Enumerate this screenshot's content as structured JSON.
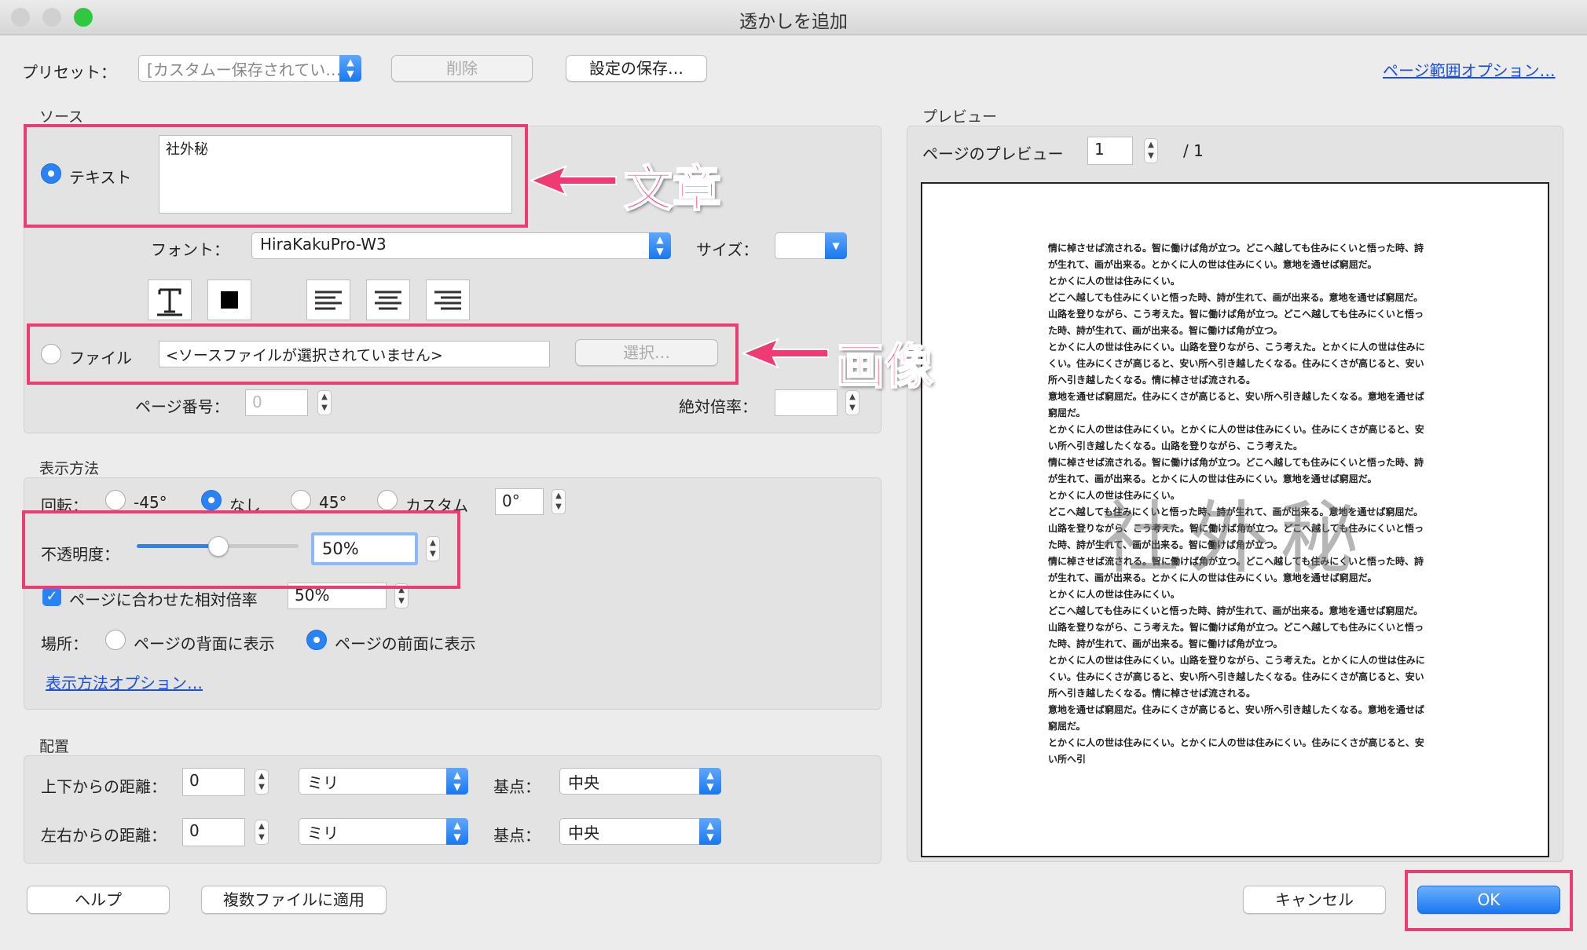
{
  "window": {
    "title": "透かしを追加"
  },
  "top": {
    "preset_label": "プリセット：",
    "preset_value": "[カスタムー保存されてい…",
    "delete_label": "削除",
    "save_settings_label": "設定の保存…",
    "page_range_link": "ページ範囲オプション…"
  },
  "source": {
    "section_label": "ソース",
    "text_radio_label": "テキスト",
    "text_value": "社外秘",
    "font_label": "フォント：",
    "font_value": "HiraKakuPro-W3",
    "size_label": "サイズ：",
    "size_value": "",
    "file_radio_label": "ファイル",
    "file_value": "<ソースファイルが選択されていません>",
    "choose_label": "選択…",
    "page_number_label": "ページ番号：",
    "page_number_value": "0",
    "absolute_scale_label": "絶対倍率：",
    "absolute_scale_value": ""
  },
  "annotations": {
    "text_callout": "文章",
    "image_callout": "画像"
  },
  "display": {
    "section_label": "表示方法",
    "rotation_label": "回転：",
    "rotation_options": [
      "-45°",
      "なし",
      "45°",
      "カスタム"
    ],
    "rotation_selected": "なし",
    "custom_angle": "0°",
    "opacity_label": "不透明度：",
    "opacity_value": "50%",
    "opacity_fraction": 0.5,
    "relative_scale_label": "ページに合わせた相対倍率",
    "relative_scale_checked": true,
    "relative_scale_value": "50%",
    "location_label": "場所：",
    "location_back": "ページの背面に表示",
    "location_front": "ページの前面に表示",
    "location_selected": "ページの前面に表示",
    "options_link": "表示方法オプション…"
  },
  "placement": {
    "section_label": "配置",
    "vertical_label": "上下からの距離：",
    "vertical_value": "0",
    "vertical_unit": "ミリ",
    "vertical_base_label": "基点：",
    "vertical_base": "中央",
    "horizontal_label": "左右からの距離：",
    "horizontal_value": "0",
    "horizontal_unit": "ミリ",
    "horizontal_base_label": "基点：",
    "horizontal_base": "中央"
  },
  "preview": {
    "section_label": "プレビュー",
    "page_preview_label": "ページのプレビュー",
    "page_value": "1",
    "page_total": "/ 1",
    "watermark_text": "社外秘",
    "text_lines": [
      "情に棹させば流される。智に働けば角が立つ。どこへ越しても住みにくいと悟った時、詩",
      "が生れて、画が出来る。とかくに人の世は住みにくい。意地を通せば窮屈だ。",
      "とかくに人の世は住みにくい。",
      "どこへ越しても住みにくいと悟った時、詩が生れて、画が出来る。意地を通せば窮屈だ。",
      "山路を登りながら、こう考えた。智に働けば角が立つ。どこへ越しても住みにくいと悟っ",
      "た時、詩が生れて、画が出来る。智に働けば角が立つ。",
      "とかくに人の世は住みにくい。山路を登りながら、こう考えた。とかくに人の世は住みに",
      "くい。住みにくさが高じると、安い所へ引き越したくなる。住みにくさが高じると、安い",
      "所へ引き越したくなる。情に棹させば流される。",
      "意地を通せば窮屈だ。住みにくさが高じると、安い所へ引き越したくなる。意地を通せば",
      "窮屈だ。",
      "とかくに人の世は住みにくい。とかくに人の世は住みにくい。住みにくさが高じると、安",
      "い所へ引き越したくなる。山路を登りながら、こう考えた。",
      "情に棹させば流される。智に働けば角が立つ。どこへ越しても住みにくいと悟った時、詩",
      "が生れて、画が出来る。とかくに人の世は住みにくい。意地を通せば窮屈だ。",
      "とかくに人の世は住みにくい。",
      "どこへ越しても住みにくいと悟った時、詩が生れて、画が出来る。意地を通せば窮屈だ。",
      "山路を登りながら、こう考えた。智に働けば角が立つ。どこへ越しても住みにくいと悟っ",
      "た時、詩が生れて、画が出来る。智に働けば角が立つ。",
      "情に棹させば流される。智に働けば角が立つ。どこへ越しても住みにくいと悟った時、詩",
      "が生れて、画が出来る。とかくに人の世は住みにくい。意地を通せば窮屈だ。",
      "とかくに人の世は住みにくい。",
      "どこへ越しても住みにくいと悟った時、詩が生れて、画が出来る。意地を通せば窮屈だ。",
      "山路を登りながら、こう考えた。智に働けば角が立つ。どこへ越しても住みにくいと悟っ",
      "た時、詩が生れて、画が出来る。智に働けば角が立つ。",
      "とかくに人の世は住みにくい。山路を登りながら、こう考えた。とかくに人の世は住みに",
      "くい。住みにくさが高じると、安い所へ引き越したくなる。住みにくさが高じると、安い",
      "所へ引き越したくなる。情に棹させば流される。",
      "意地を通せば窮屈だ。住みにくさが高じると、安い所へ引き越したくなる。意地を通せば",
      "窮屈だ。",
      "とかくに人の世は住みにくい。とかくに人の世は住みにくい。住みにくさが高じると、安",
      "い所へ引"
    ]
  },
  "bottom": {
    "help_label": "ヘルプ",
    "apply_multiple_label": "複数ファイルに適用",
    "cancel_label": "キャンセル",
    "ok_label": "OK"
  },
  "colors": {
    "accent": "#2a83f6",
    "highlight": "#ef3b74"
  }
}
